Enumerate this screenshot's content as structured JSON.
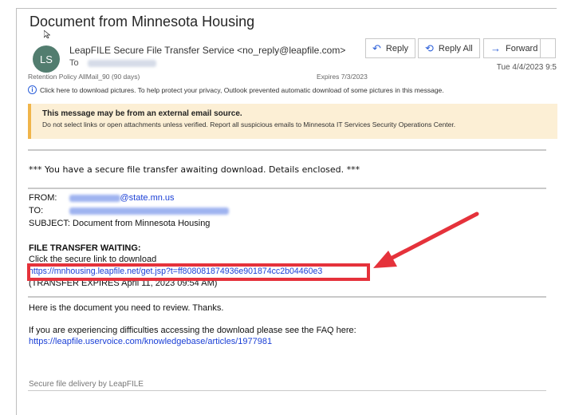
{
  "email": {
    "subject": "Document from Minnesota Housing",
    "avatar": "LS",
    "sender": "LeapFILE Secure File Transfer Service <no_reply@leapfile.com>",
    "to_label": "To",
    "date": "Tue 4/4/2023 9:5",
    "retention": "Retention Policy  AllMail_90 (90 days)",
    "expires": "Expires  7/3/2023",
    "info_text": "Click here to download pictures. To help protect your privacy, Outlook prevented automatic download of some pictures in this message."
  },
  "actions": {
    "reply": "Reply",
    "reply_all": "Reply All",
    "forward": "Forward"
  },
  "warning": {
    "title": "This message may be from an external email source.",
    "detail": "Do not select links or open attachments unless verified. Report all suspicious emails to Minnesota IT Services Security Operations Center."
  },
  "body": {
    "intro": "*** You have a secure file transfer awaiting download. Details enclosed. ***",
    "from_label": "FROM:",
    "from_domain": "@state.mn.us",
    "to_label": "TO:",
    "subject_line": "SUBJECT: Document from Minnesota Housing",
    "ft_title": "FILE TRANSFER WAITING:",
    "click_text": "Click the secure link to download",
    "link": "https://mnhousing.leapfile.net/get.jsp?t=ff808081874936e901874cc2b04460e3",
    "expires_text": "(TRANSFER EXPIRES April 11, 2023 09:54 AM)",
    "review_text": "Here is the document you need to review. Thanks.",
    "faq_text": "If you are experiencing difficulties accessing the download please see the FAQ here:",
    "faq_link": "https://leapfile.uservoice.com/knowledgebase/articles/1977981",
    "footer": "Secure file delivery by LeapFILE"
  },
  "colors": {
    "annotation_red": "#e5323b",
    "link_blue": "#1a3fd6",
    "warning_bg": "#fcefd5"
  },
  "icons": [
    "reply-icon",
    "reply-all-icon",
    "forward-icon",
    "info-icon",
    "cursor-icon",
    "arrow-annotation"
  ]
}
